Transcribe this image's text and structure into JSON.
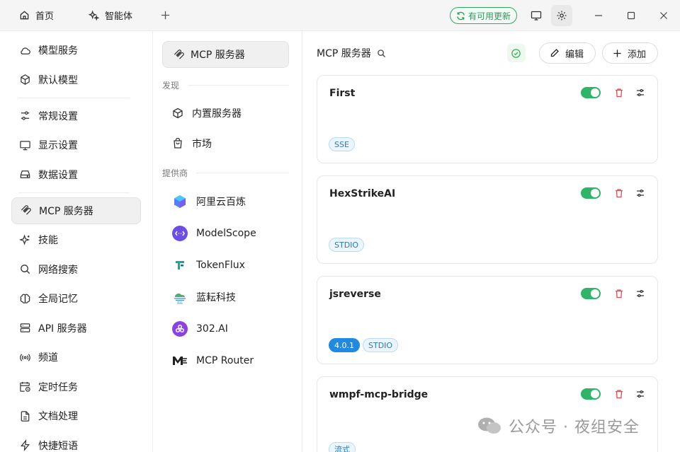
{
  "titlebar": {
    "tabs": [
      {
        "label": "首页",
        "icon": "home-icon"
      },
      {
        "label": "智能体",
        "icon": "sparkle-icon"
      }
    ],
    "update_label": "有可用更新"
  },
  "sidebar": {
    "items": [
      {
        "label": "模型服务",
        "icon": "cloud-icon"
      },
      {
        "label": "默认模型",
        "icon": "cube-icon"
      },
      {
        "label": "常规设置",
        "icon": "sliders-icon"
      },
      {
        "label": "显示设置",
        "icon": "monitor-icon"
      },
      {
        "label": "数据设置",
        "icon": "drive-icon"
      },
      {
        "label": "MCP 服务器",
        "icon": "mcp-icon",
        "active": true
      },
      {
        "label": "技能",
        "icon": "sparkle-icon"
      },
      {
        "label": "网络搜索",
        "icon": "search-icon"
      },
      {
        "label": "全局记忆",
        "icon": "brain-icon"
      },
      {
        "label": "API 服务器",
        "icon": "server-icon"
      },
      {
        "label": "频道",
        "icon": "radio-icon"
      },
      {
        "label": "定时任务",
        "icon": "calendar-clock-icon"
      },
      {
        "label": "文档处理",
        "icon": "document-icon"
      },
      {
        "label": "快捷短语",
        "icon": "zap-icon"
      }
    ]
  },
  "midcol": {
    "active_label": "MCP 服务器",
    "discover_title": "发现",
    "discover_items": [
      {
        "label": "内置服务器",
        "icon": "box-icon"
      },
      {
        "label": "市场",
        "icon": "shopping-bag-icon"
      }
    ],
    "providers_title": "提供商",
    "providers": [
      {
        "label": "阿里云百炼",
        "icon": "bailian-logo-icon"
      },
      {
        "label": "ModelScope",
        "icon": "modelscope-logo-icon"
      },
      {
        "label": "TokenFlux",
        "icon": "tokenflux-logo-icon"
      },
      {
        "label": "蓝耘科技",
        "icon": "lanyun-logo-icon"
      },
      {
        "label": "302.AI",
        "icon": "302ai-logo-icon"
      },
      {
        "label": "MCP Router",
        "icon": "mcp-router-logo-icon"
      }
    ]
  },
  "main": {
    "title": "MCP 服务器",
    "edit_label": "编辑",
    "add_label": "添加",
    "servers": [
      {
        "name": "First",
        "enabled": true,
        "tags": [
          "SSE"
        ],
        "version": ""
      },
      {
        "name": "HexStrikeAI",
        "enabled": true,
        "tags": [
          "STDIO"
        ],
        "version": ""
      },
      {
        "name": "jsreverse",
        "enabled": true,
        "tags": [
          "STDIO"
        ],
        "version": "4.0.1"
      },
      {
        "name": "wmpf-mcp-bridge",
        "enabled": true,
        "tags": [
          "流式"
        ],
        "version": ""
      }
    ]
  },
  "watermark": {
    "text": "公众号 · 夜组安全"
  },
  "colors": {
    "accent_green": "#2eb567",
    "tag_blue": "#2b7ab8",
    "version_blue": "#1f8ae0",
    "delete_red": "#e5484d"
  }
}
